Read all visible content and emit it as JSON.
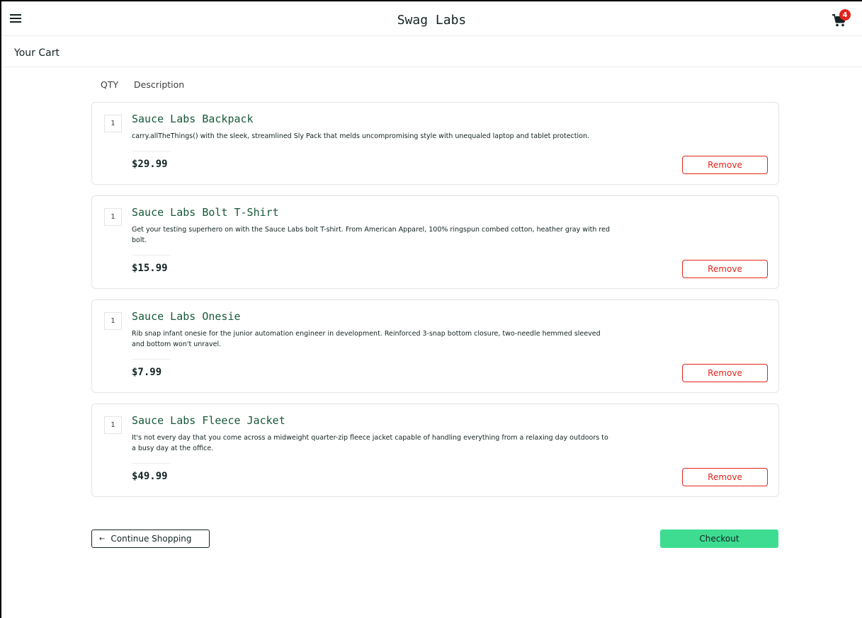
{
  "header": {
    "title": "Swag Labs",
    "cart_count": "4"
  },
  "page": {
    "title": "Your Cart"
  },
  "columns": {
    "qty": "QTY",
    "description": "Description"
  },
  "items": [
    {
      "qty": "1",
      "name": "Sauce Labs Backpack",
      "description": "carry.allTheThings() with the sleek, streamlined Sly Pack that melds uncompromising style with unequaled laptop and tablet protection.",
      "price": "$29.99",
      "remove_label": "Remove"
    },
    {
      "qty": "1",
      "name": "Sauce Labs Bolt T-Shirt",
      "description": "Get your testing superhero on with the Sauce Labs bolt T-shirt. From American Apparel, 100% ringspun combed cotton, heather gray with red bolt.",
      "price": "$15.99",
      "remove_label": "Remove"
    },
    {
      "qty": "1",
      "name": "Sauce Labs Onesie",
      "description": "Rib snap infant onesie for the junior automation engineer in development. Reinforced 3-snap bottom closure, two-needle hemmed sleeved and bottom won't unravel.",
      "price": "$7.99",
      "remove_label": "Remove"
    },
    {
      "qty": "1",
      "name": "Sauce Labs Fleece Jacket",
      "description": "It's not every day that you come across a midweight quarter-zip fleece jacket capable of handling everything from a relaxing day outdoors to a busy day at the office.",
      "price": "$49.99",
      "remove_label": "Remove"
    }
  ],
  "footer": {
    "continue_label": "Continue Shopping",
    "checkout_label": "Checkout"
  },
  "colors": {
    "accent": "#3ddc91",
    "danger": "#e2231a",
    "item_name": "#18583a"
  }
}
